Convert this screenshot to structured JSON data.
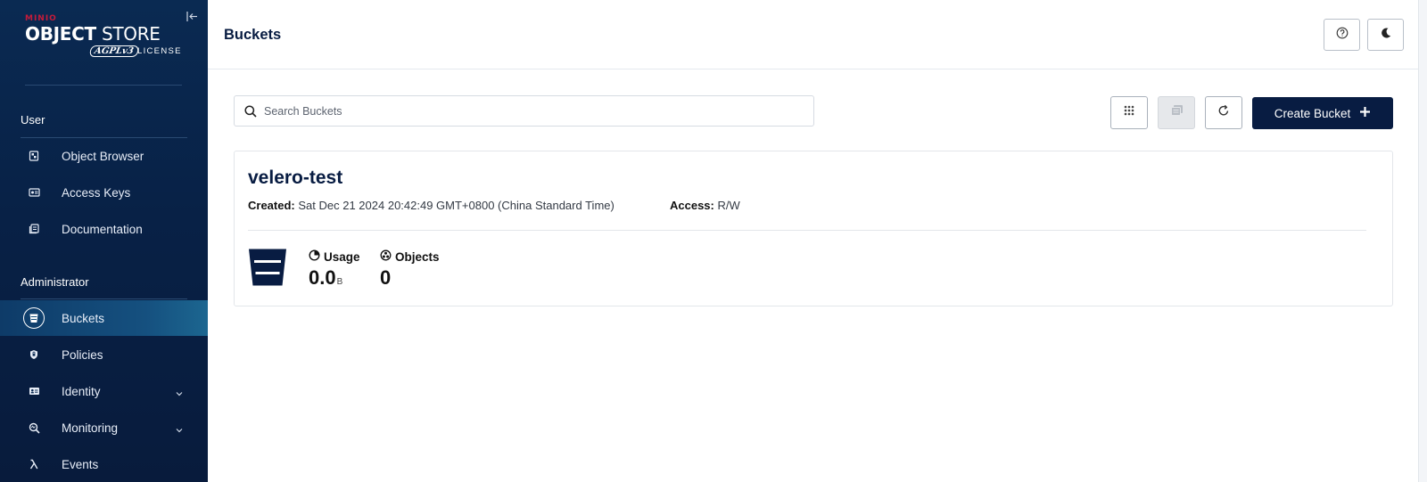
{
  "app": {
    "brand_small": "MINIO",
    "brand_bold": "OBJECT",
    "brand_light": "STORE",
    "badge": "AGPLv3",
    "license": "LICENSE"
  },
  "sidebar": {
    "user_section": "User",
    "user_items": [
      {
        "label": "Object Browser",
        "icon": "object-browser-icon"
      },
      {
        "label": "Access Keys",
        "icon": "access-keys-icon"
      },
      {
        "label": "Documentation",
        "icon": "documentation-icon"
      }
    ],
    "admin_section": "Administrator",
    "admin_items": [
      {
        "label": "Buckets",
        "icon": "bucket-icon",
        "active": true
      },
      {
        "label": "Policies",
        "icon": "shield-icon"
      },
      {
        "label": "Identity",
        "icon": "identity-icon",
        "expandable": true
      },
      {
        "label": "Monitoring",
        "icon": "monitoring-icon",
        "expandable": true
      },
      {
        "label": "Events",
        "icon": "lambda-icon"
      }
    ]
  },
  "header": {
    "title": "Buckets"
  },
  "toolbar": {
    "search_placeholder": "Search Buckets",
    "create_label": "Create Bucket"
  },
  "buckets": [
    {
      "name": "velero-test",
      "created_label": "Created:",
      "created_value": "Sat Dec 21 2024 20:42:49 GMT+0800 (China Standard Time)",
      "access_label": "Access:",
      "access_value": "R/W",
      "usage_label": "Usage",
      "usage_value": "0.0",
      "usage_unit": "B",
      "objects_label": "Objects",
      "objects_value": "0"
    }
  ],
  "colors": {
    "sidebar_bg": "#082146",
    "primary": "#081c42",
    "brand_red": "#c51b3a",
    "active_item": "#15507f"
  }
}
